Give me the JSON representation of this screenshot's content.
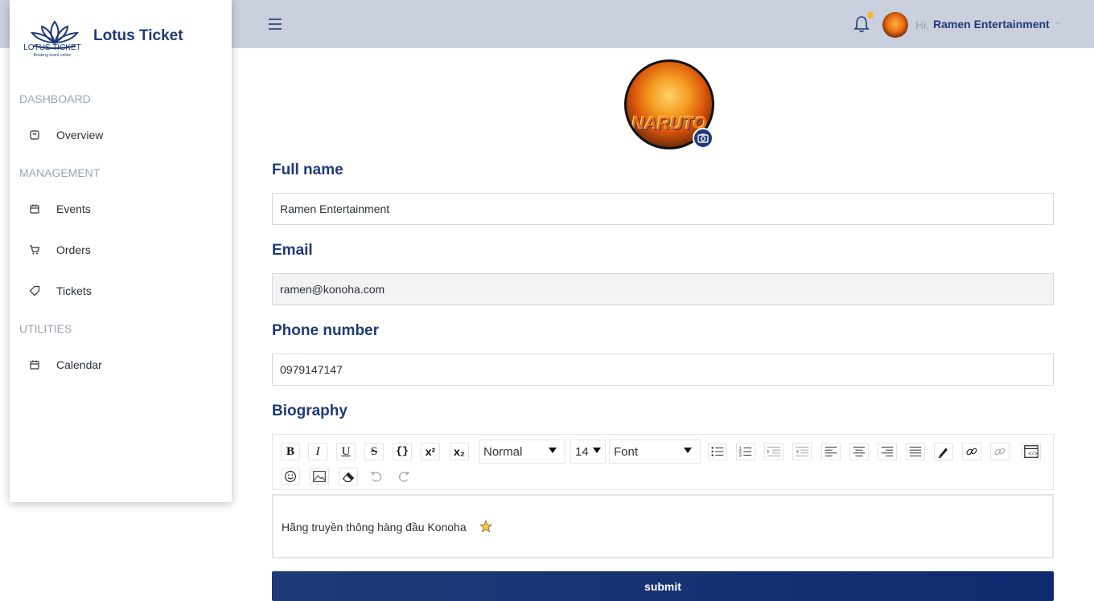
{
  "app": {
    "brand": "Lotus Ticket",
    "logo_text": "LOTUS TICKET",
    "logo_sub": "Booking event online"
  },
  "header": {
    "greeting": "Hi,",
    "user_name": "Ramen Entertainment",
    "notification_dot": true
  },
  "sidebar": {
    "sections": [
      {
        "title": "DASHBOARD",
        "items": [
          {
            "label": "Overview",
            "icon": "bag-icon"
          }
        ]
      },
      {
        "title": "MANAGEMENT",
        "items": [
          {
            "label": "Events",
            "icon": "calendar-icon"
          },
          {
            "label": "Orders",
            "icon": "cart-icon"
          },
          {
            "label": "Tickets",
            "icon": "tag-icon"
          }
        ]
      },
      {
        "title": "UTILITIES",
        "items": [
          {
            "label": "Calendar",
            "icon": "calendar-icon"
          }
        ]
      }
    ]
  },
  "profile": {
    "avatar_text": "NARUTO",
    "full_name": {
      "label": "Full name",
      "value": "Ramen Entertainment"
    },
    "email": {
      "label": "Email",
      "value": "ramen@konoha.com"
    },
    "phone": {
      "label": "Phone number",
      "value": "0979147147"
    },
    "biography": {
      "label": "Biography",
      "text": "Hãng truyền thông hàng đầu Konoha",
      "toolbar": {
        "heading_select": "Normal",
        "size_select": "14",
        "font_select": "Font"
      }
    },
    "submit_label": "submit"
  },
  "colors": {
    "accent": "#1f3a78",
    "topbar": "#cbd0de",
    "muted": "#9aa3b8",
    "badge": "#f5b82e"
  }
}
